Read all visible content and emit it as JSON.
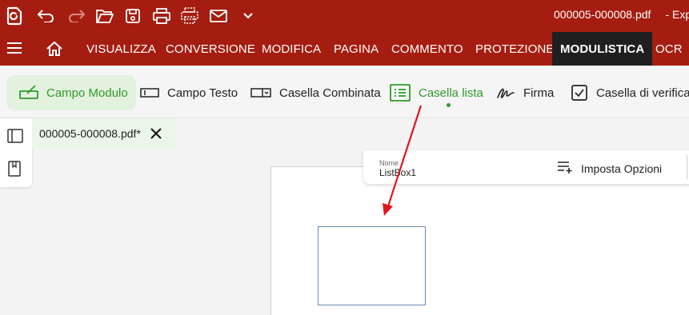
{
  "window": {
    "doc_title": "000005-000008.pdf",
    "doc_title_suffix": "- Exp"
  },
  "toolbar": {
    "icons": [
      "app-logo-icon",
      "undo-icon",
      "redo-icon",
      "open-folder-icon",
      "save-icon",
      "print-icon",
      "print-scan-icon",
      "email-icon",
      "chevron-down-icon"
    ]
  },
  "menu": {
    "items": [
      "VISUALIZZA",
      "CONVERSIONE",
      "MODIFICA",
      "PAGINA",
      "COMMENTO",
      "PROTEZIONE",
      "MODULISTICA",
      "OCR"
    ],
    "active": "MODULISTICA"
  },
  "ribbon": {
    "campo_modulo": "Campo Modulo",
    "campo_testo": "Campo Testo",
    "casella_combinata": "Casella Combinata",
    "casella_lista": "Casella lista",
    "firma": "Firma",
    "casella_verifica": "Casella di verifica"
  },
  "tab": {
    "name": "000005-000008.pdf*"
  },
  "properties": {
    "name_label": "Nome",
    "name_value": "ListBox1",
    "set_options": "Imposta Opzioni"
  },
  "colors": {
    "brand_red": "#a51d10",
    "active_menu": "#1f1f1f",
    "accent_green": "#2e9a2b",
    "annotation_arrow": "#e0161c"
  }
}
